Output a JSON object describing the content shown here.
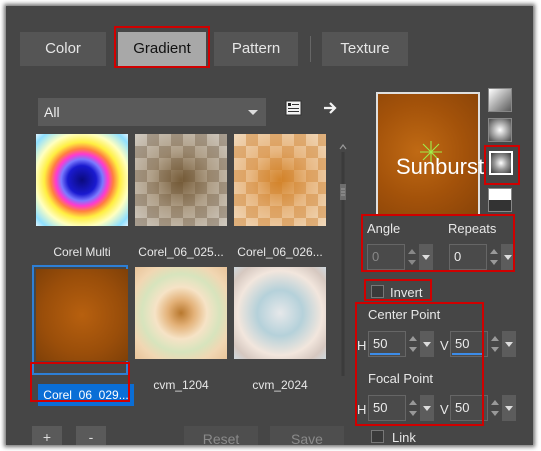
{
  "tabs": [
    {
      "label": "Color"
    },
    {
      "label": "Gradient"
    },
    {
      "label": "Pattern"
    },
    {
      "label": "Texture"
    }
  ],
  "library": {
    "filter_value": "All",
    "items": [
      {
        "label": "Corel Multi"
      },
      {
        "label": "Corel_06_025..."
      },
      {
        "label": "Corel_06_026..."
      },
      {
        "label": "Corel_06_029..."
      },
      {
        "label": "cvm_1204"
      },
      {
        "label": "cvm_2024"
      }
    ],
    "add_label": "+",
    "remove_label": "-",
    "reset_label": "Reset",
    "save_label": "Save"
  },
  "preview": {
    "label": "Sunburst"
  },
  "settings": {
    "angle_label": "Angle",
    "angle_value": "0",
    "repeats_label": "Repeats",
    "repeats_value": "0",
    "invert_label": "Invert",
    "center_point_label": "Center Point",
    "center_h_label": "H",
    "center_h_value": "50",
    "center_v_label": "V",
    "center_v_value": "50",
    "focal_point_label": "Focal Point",
    "focal_h_label": "H",
    "focal_h_value": "50",
    "focal_v_label": "V",
    "focal_v_value": "50",
    "link_label": "Link"
  },
  "colors": {
    "highlight": "#d00000",
    "selection": "#0a6ed6",
    "slider_accent": "#3c8ce8"
  }
}
